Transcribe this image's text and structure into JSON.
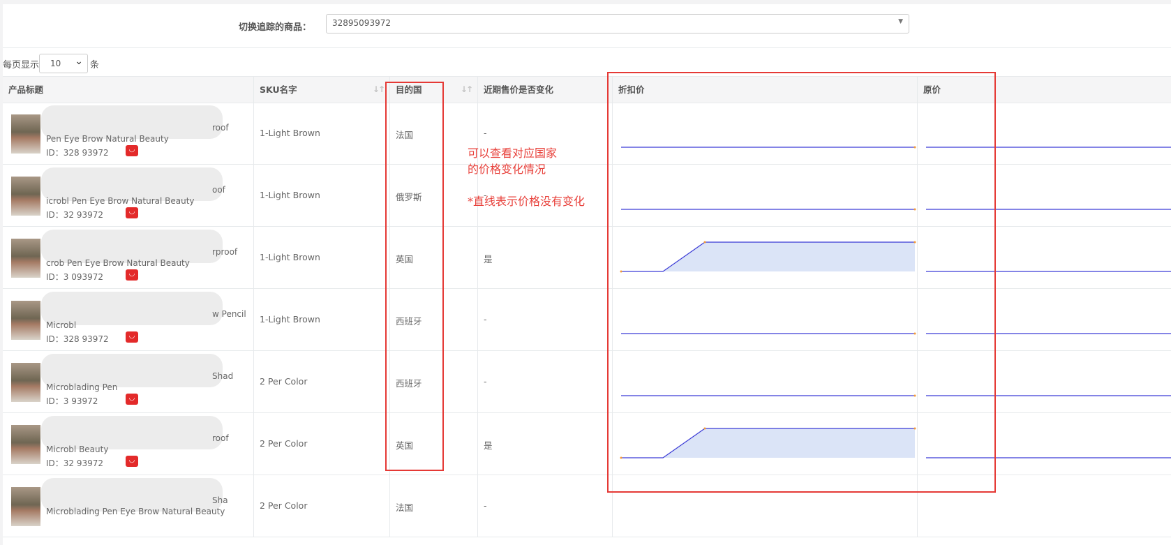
{
  "filter": {
    "label": "切换追踪的商品：",
    "selected": "32895093972"
  },
  "pager": {
    "prefix": "每页显示",
    "value": "10",
    "suffix": "条"
  },
  "columns": {
    "title": "产品标题",
    "sku": "SKU名字",
    "country": "目的国",
    "changed": "近期售价是否变化",
    "discount": "折扣价",
    "original": "原价"
  },
  "rows": [
    {
      "title_line1": "Pen Eye Brow Natural Beauty",
      "title_line2": "roof",
      "id": "ID：328  93972",
      "sku": "1-Light Brown",
      "country": "法国",
      "changed": "-",
      "trend": "flat"
    },
    {
      "title_line1": "icrobl    Pen Eye Brow Natural Beauty",
      "title_line2": "oof",
      "id": "ID：32   93972",
      "sku": "1-Light Brown",
      "country": "俄罗斯",
      "changed": "-",
      "trend": "flat"
    },
    {
      "title_line1": "crob   Pen Eye Brow Natural Beauty",
      "title_line2": "rproof",
      "id": "ID：3    093972",
      "sku": "1-Light Brown",
      "country": "英国",
      "changed": "是",
      "trend": "rise"
    },
    {
      "title_line1": "Microbl",
      "title_line2": "w Pencil",
      "id": "ID：328    93972",
      "sku": "1-Light Brown",
      "country": "西班牙",
      "changed": "-",
      "trend": "flat"
    },
    {
      "title_line1": "Microblading Pen",
      "title_line2": "Shad",
      "id": "ID：3     93972",
      "sku": "2 Per Color",
      "country": "西班牙",
      "changed": "-",
      "trend": "flat"
    },
    {
      "title_line1": "Microbl           Beauty",
      "title_line2": "roof",
      "id": "ID：32    93972",
      "sku": "2 Per Color",
      "country": "英国",
      "changed": "是",
      "trend": "rise"
    },
    {
      "title_line1": "Microblading Pen Eye Brow Natural Beauty",
      "title_line2": "Sha",
      "id": "",
      "sku": "2 Per Color",
      "country": "法国",
      "changed": "-",
      "trend": "none"
    }
  ],
  "annotations": {
    "line1": "可以查看对应国家",
    "line2": "的价格变化情况",
    "line3": "*直线表示价格没有变化"
  },
  "colors": {
    "line": "#3b3bd6",
    "fill": "#dbe4f7",
    "highlight": "#e53935"
  }
}
